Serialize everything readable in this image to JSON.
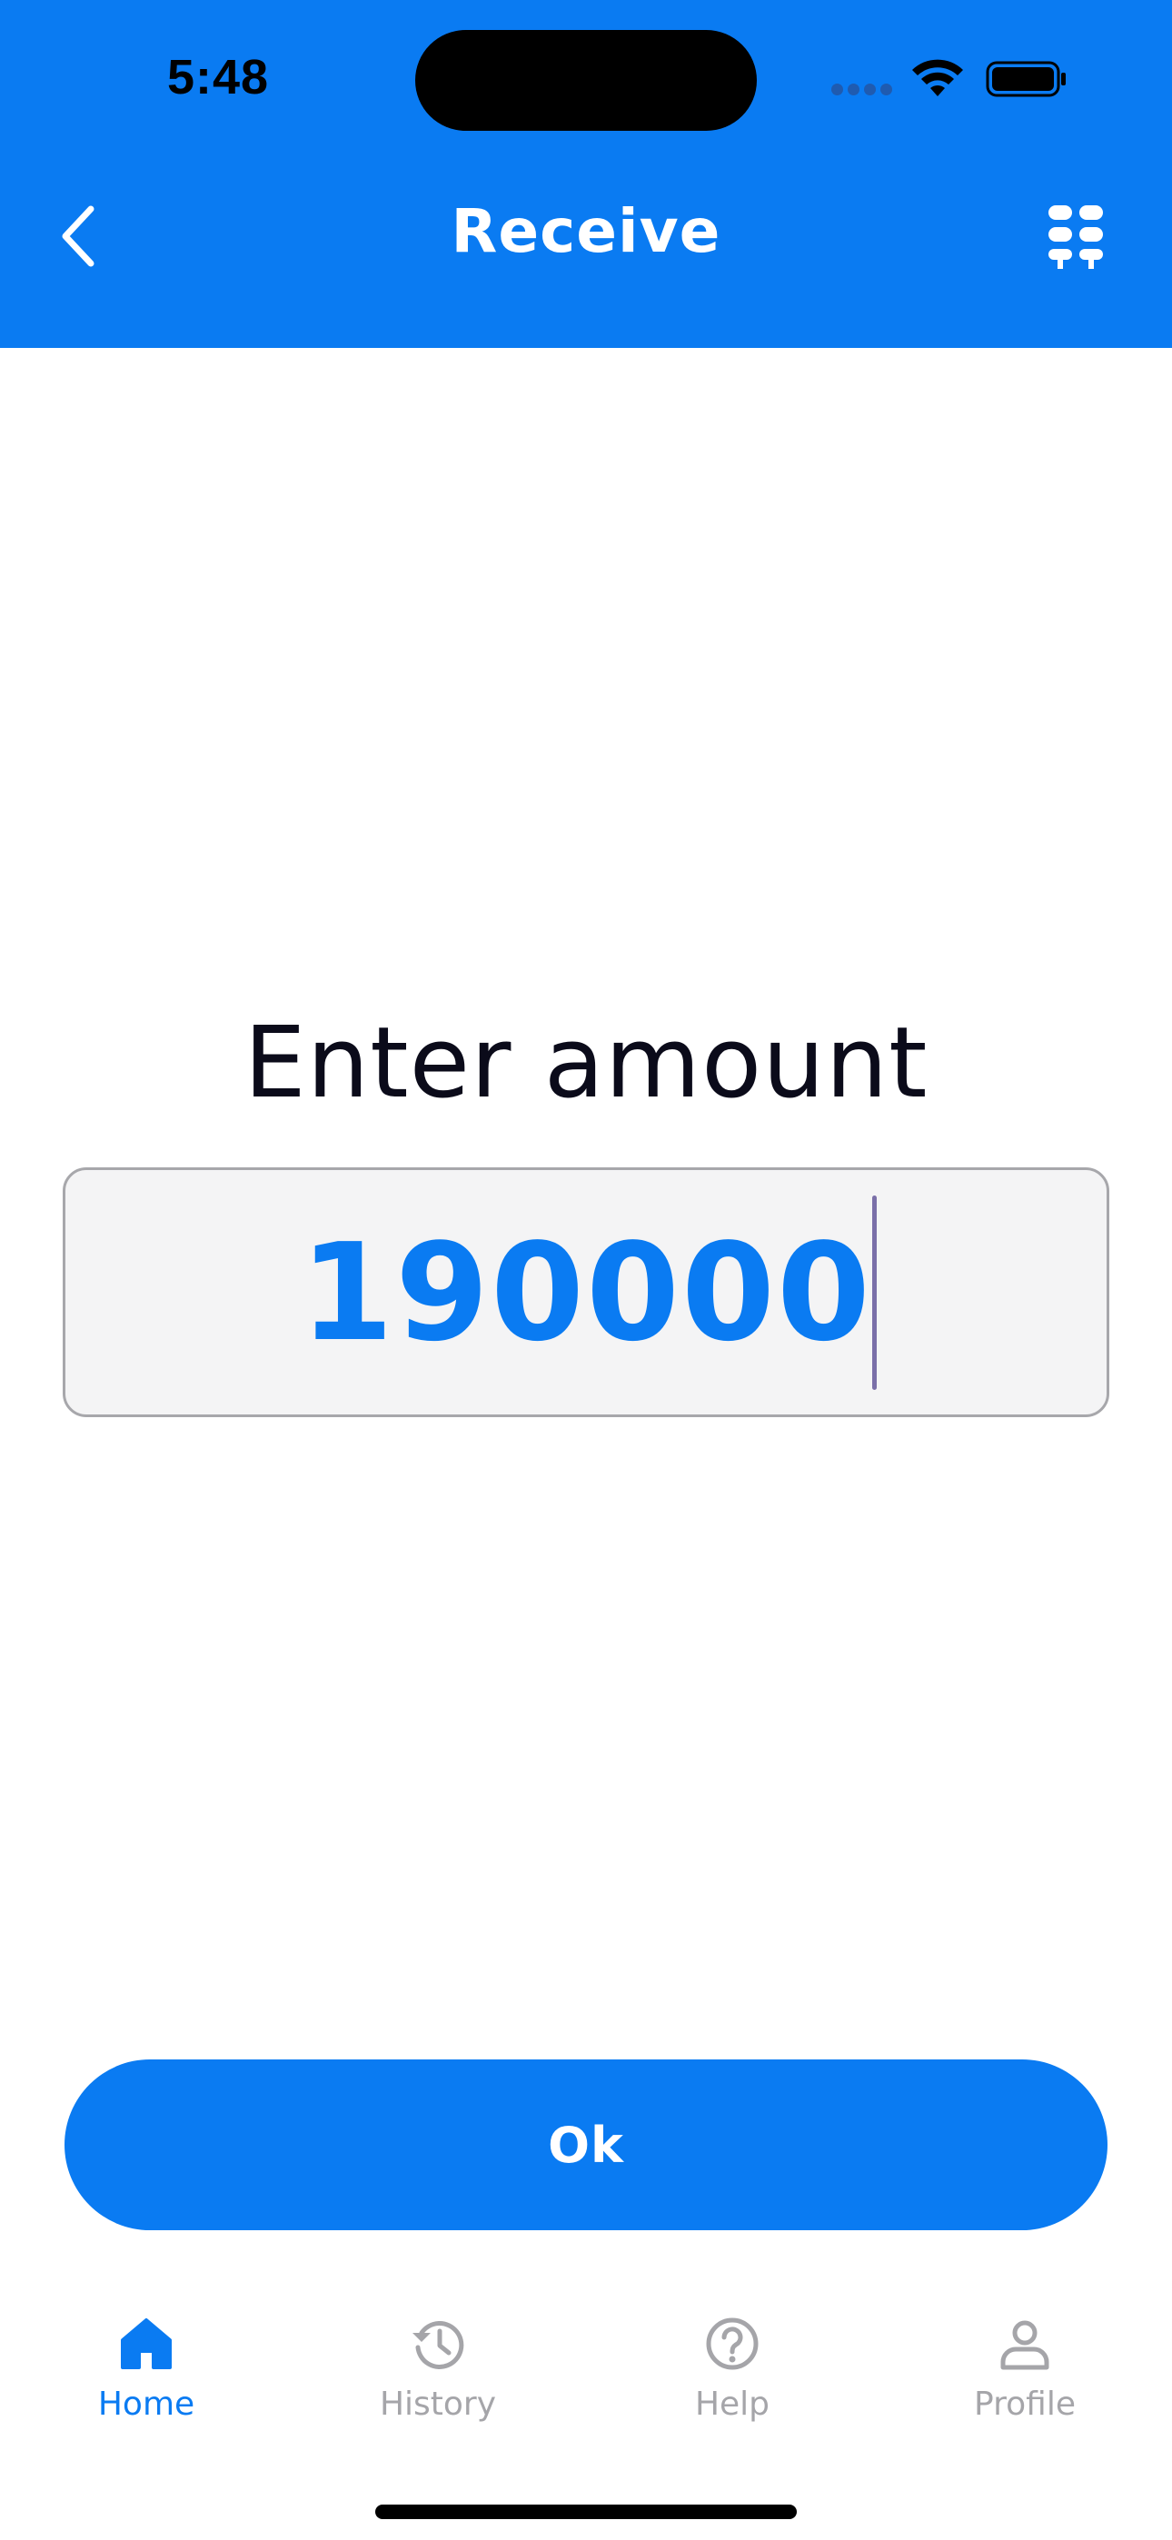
{
  "status_bar": {
    "time": "5:48"
  },
  "header": {
    "title": "Receive",
    "back_icon": "chevron-left-icon",
    "action_icon": "grid-dots-icon"
  },
  "form": {
    "prompt": "Enter amount",
    "amount_value": "190000"
  },
  "actions": {
    "ok_label": "Ok"
  },
  "tab_bar": {
    "items": [
      {
        "label": "Home",
        "icon": "home-icon",
        "active": true
      },
      {
        "label": "History",
        "icon": "history-icon",
        "active": false
      },
      {
        "label": "Help",
        "icon": "help-icon",
        "active": false
      },
      {
        "label": "Profile",
        "icon": "profile-icon",
        "active": false
      }
    ]
  },
  "colors": {
    "brand_blue": "#0a7bf2",
    "inactive_gray": "#a5a5a9",
    "input_bg": "#f4f4f5"
  }
}
